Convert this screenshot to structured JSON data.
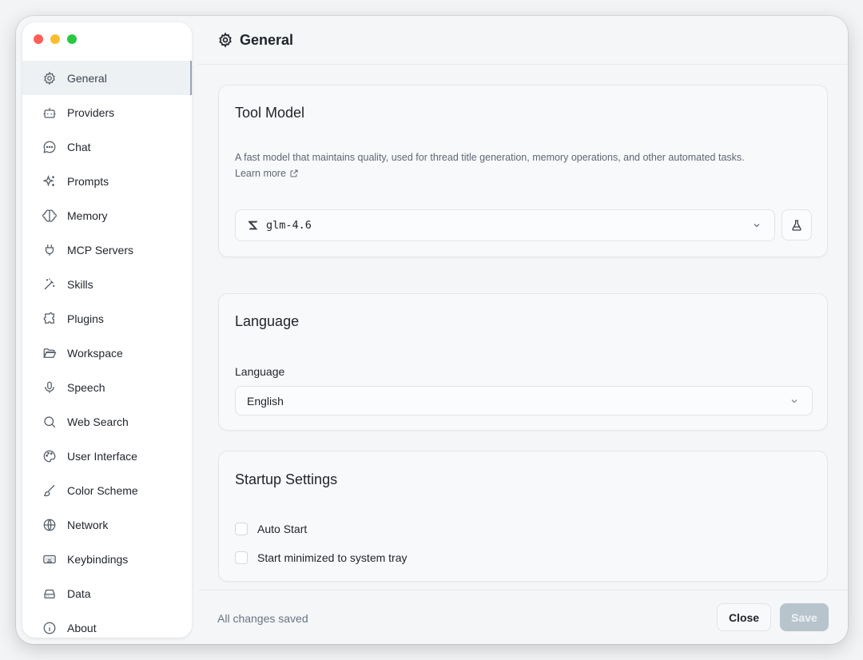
{
  "sidebar": {
    "items": [
      {
        "label": "General",
        "icon": "gear-icon"
      },
      {
        "label": "Providers",
        "icon": "bot-icon"
      },
      {
        "label": "Chat",
        "icon": "chat-bubble-icon"
      },
      {
        "label": "Prompts",
        "icon": "sparkles-icon"
      },
      {
        "label": "Memory",
        "icon": "brain-icon"
      },
      {
        "label": "MCP Servers",
        "icon": "plug-icon"
      },
      {
        "label": "Skills",
        "icon": "magic-wand-icon"
      },
      {
        "label": "Plugins",
        "icon": "puzzle-icon"
      },
      {
        "label": "Workspace",
        "icon": "folder-open-icon"
      },
      {
        "label": "Speech",
        "icon": "microphone-icon"
      },
      {
        "label": "Web Search",
        "icon": "search-icon"
      },
      {
        "label": "User Interface",
        "icon": "palette-icon"
      },
      {
        "label": "Color Scheme",
        "icon": "brush-icon"
      },
      {
        "label": "Network",
        "icon": "globe-icon"
      },
      {
        "label": "Keybindings",
        "icon": "keyboard-icon"
      },
      {
        "label": "Data",
        "icon": "hard-drive-icon"
      },
      {
        "label": "About",
        "icon": "info-icon"
      }
    ],
    "active": "General"
  },
  "header": {
    "title": "General",
    "icon": "gear-icon"
  },
  "tool_model": {
    "title": "Tool Model",
    "description": "A fast model that maintains quality, used for thread title generation, memory operations, and other automated tasks.",
    "learn_more": "Learn more",
    "selected_model": "glm-4.6",
    "model_icon": "zhipu-z-logo-icon",
    "test_icon": "flask-icon"
  },
  "language": {
    "title": "Language",
    "label": "Language",
    "selected": "English"
  },
  "startup": {
    "title": "Startup Settings",
    "auto_start": "Auto Start",
    "start_minimized": "Start minimized to system tray"
  },
  "footer": {
    "status": "All changes saved",
    "close_label": "Close",
    "save_label": "Save"
  },
  "colors": {
    "accent_inactive_save": "#b8c4cc",
    "active_nav_bg": "#eef1f4"
  }
}
